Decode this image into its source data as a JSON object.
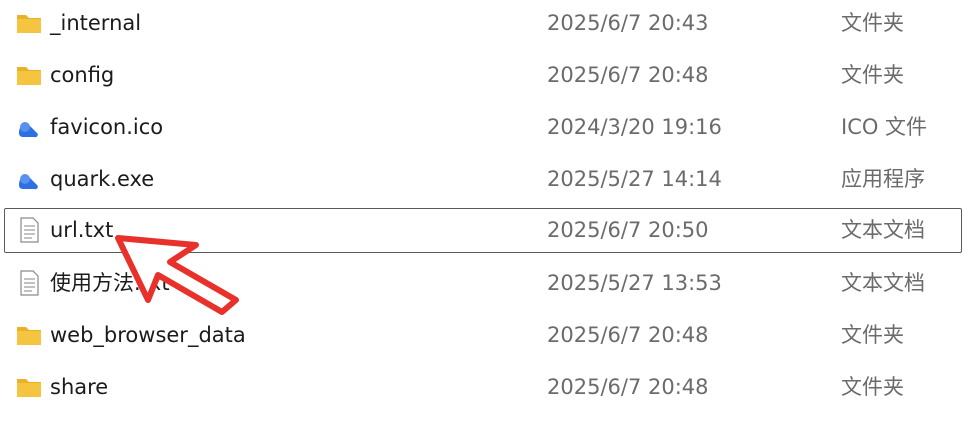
{
  "files": [
    {
      "name": "_internal",
      "date": "2025/6/7 20:43",
      "type": "文件夹",
      "icon": "folder-icon"
    },
    {
      "name": "config",
      "date": "2025/6/7 20:48",
      "type": "文件夹",
      "icon": "folder-icon"
    },
    {
      "name": "favicon.ico",
      "date": "2024/3/20 19:16",
      "type": "ICO 文件",
      "icon": "cloud-icon"
    },
    {
      "name": "quark.exe",
      "date": "2025/5/27 14:14",
      "type": "应用程序",
      "icon": "cloud-icon"
    },
    {
      "name": "url.txt",
      "date": "2025/6/7 20:50",
      "type": "文本文档",
      "icon": "text-file-icon",
      "selected": true
    },
    {
      "name": "使用方法.txt",
      "date": "2025/5/27 13:53",
      "type": "文本文档",
      "icon": "text-file-icon"
    },
    {
      "name": "web_browser_data",
      "date": "2025/6/7 20:48",
      "type": "文件夹",
      "icon": "folder-icon"
    },
    {
      "name": "share",
      "date": "2025/6/7 20:48",
      "type": "文件夹",
      "icon": "folder-icon"
    }
  ],
  "colors": {
    "folder": "#f5c542",
    "folder_dark": "#e8b127",
    "cloud_blue": "#2f6fe4",
    "arrow_red": "#e8312a",
    "selection_border": "#5a5a5a"
  }
}
